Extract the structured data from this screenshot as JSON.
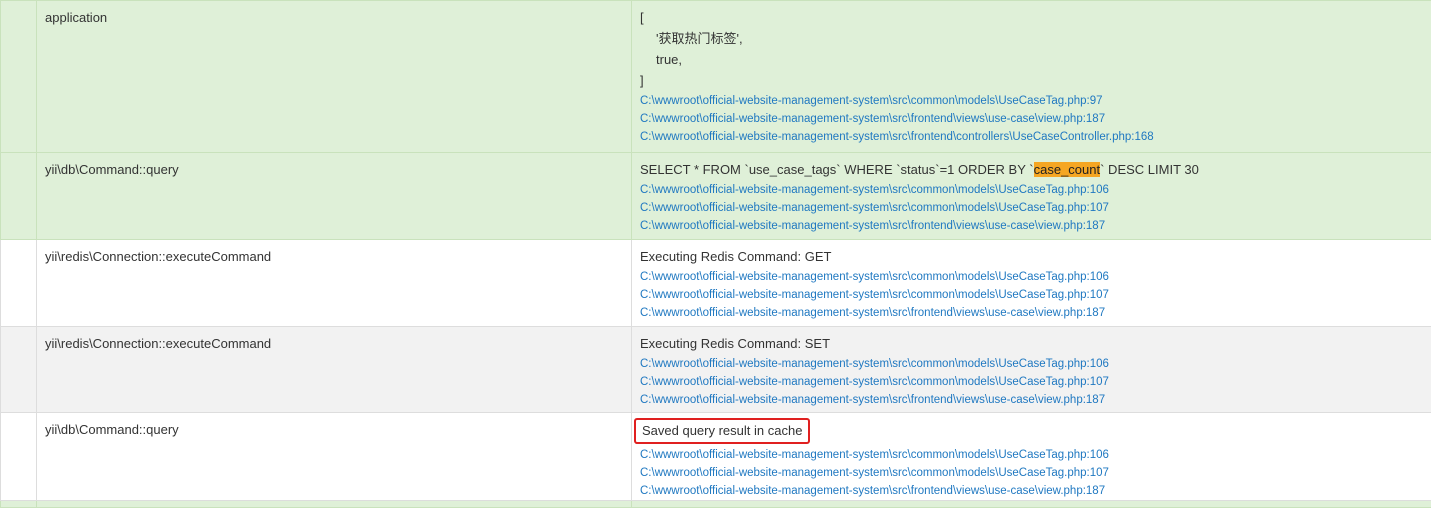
{
  "rows": [
    {
      "category": "application",
      "message_lines": [
        "[",
        "'获取热门标签',",
        "true,",
        "]"
      ],
      "trace": [
        "C:\\wwwroot\\official-website-management-system\\src\\common\\models\\UseCaseTag.php:97",
        "C:\\wwwroot\\official-website-management-system\\src\\frontend\\views\\use-case\\view.php:187",
        "C:\\wwwroot\\official-website-management-system\\src\\frontend\\controllers\\UseCaseController.php:168"
      ]
    },
    {
      "category": "yii\\db\\Command::query",
      "message_before": "SELECT * FROM `use_case_tags` WHERE `status`=1 ORDER BY `",
      "message_highlight": "case_count",
      "message_after": "` DESC LIMIT 30",
      "trace": [
        "C:\\wwwroot\\official-website-management-system\\src\\common\\models\\UseCaseTag.php:106",
        "C:\\wwwroot\\official-website-management-system\\src\\common\\models\\UseCaseTag.php:107",
        "C:\\wwwroot\\official-website-management-system\\src\\frontend\\views\\use-case\\view.php:187"
      ]
    },
    {
      "category": "yii\\redis\\Connection::executeCommand",
      "message": "Executing Redis Command: GET",
      "trace": [
        "C:\\wwwroot\\official-website-management-system\\src\\common\\models\\UseCaseTag.php:106",
        "C:\\wwwroot\\official-website-management-system\\src\\common\\models\\UseCaseTag.php:107",
        "C:\\wwwroot\\official-website-management-system\\src\\frontend\\views\\use-case\\view.php:187"
      ]
    },
    {
      "category": "yii\\redis\\Connection::executeCommand",
      "message": "Executing Redis Command: SET",
      "trace": [
        "C:\\wwwroot\\official-website-management-system\\src\\common\\models\\UseCaseTag.php:106",
        "C:\\wwwroot\\official-website-management-system\\src\\common\\models\\UseCaseTag.php:107",
        "C:\\wwwroot\\official-website-management-system\\src\\frontend\\views\\use-case\\view.php:187"
      ]
    },
    {
      "category": "yii\\db\\Command::query",
      "message": "Saved query result in cache",
      "trace": [
        "C:\\wwwroot\\official-website-management-system\\src\\common\\models\\UseCaseTag.php:106",
        "C:\\wwwroot\\official-website-management-system\\src\\common\\models\\UseCaseTag.php:107",
        "C:\\wwwroot\\official-website-management-system\\src\\frontend\\views\\use-case\\view.php:187"
      ]
    }
  ],
  "colors": {
    "row_green": "#dff0d8",
    "row_gray": "#f2f2f2",
    "link": "#1f78c1",
    "highlight": "#f5a623",
    "annotation_box": "#e02020"
  }
}
